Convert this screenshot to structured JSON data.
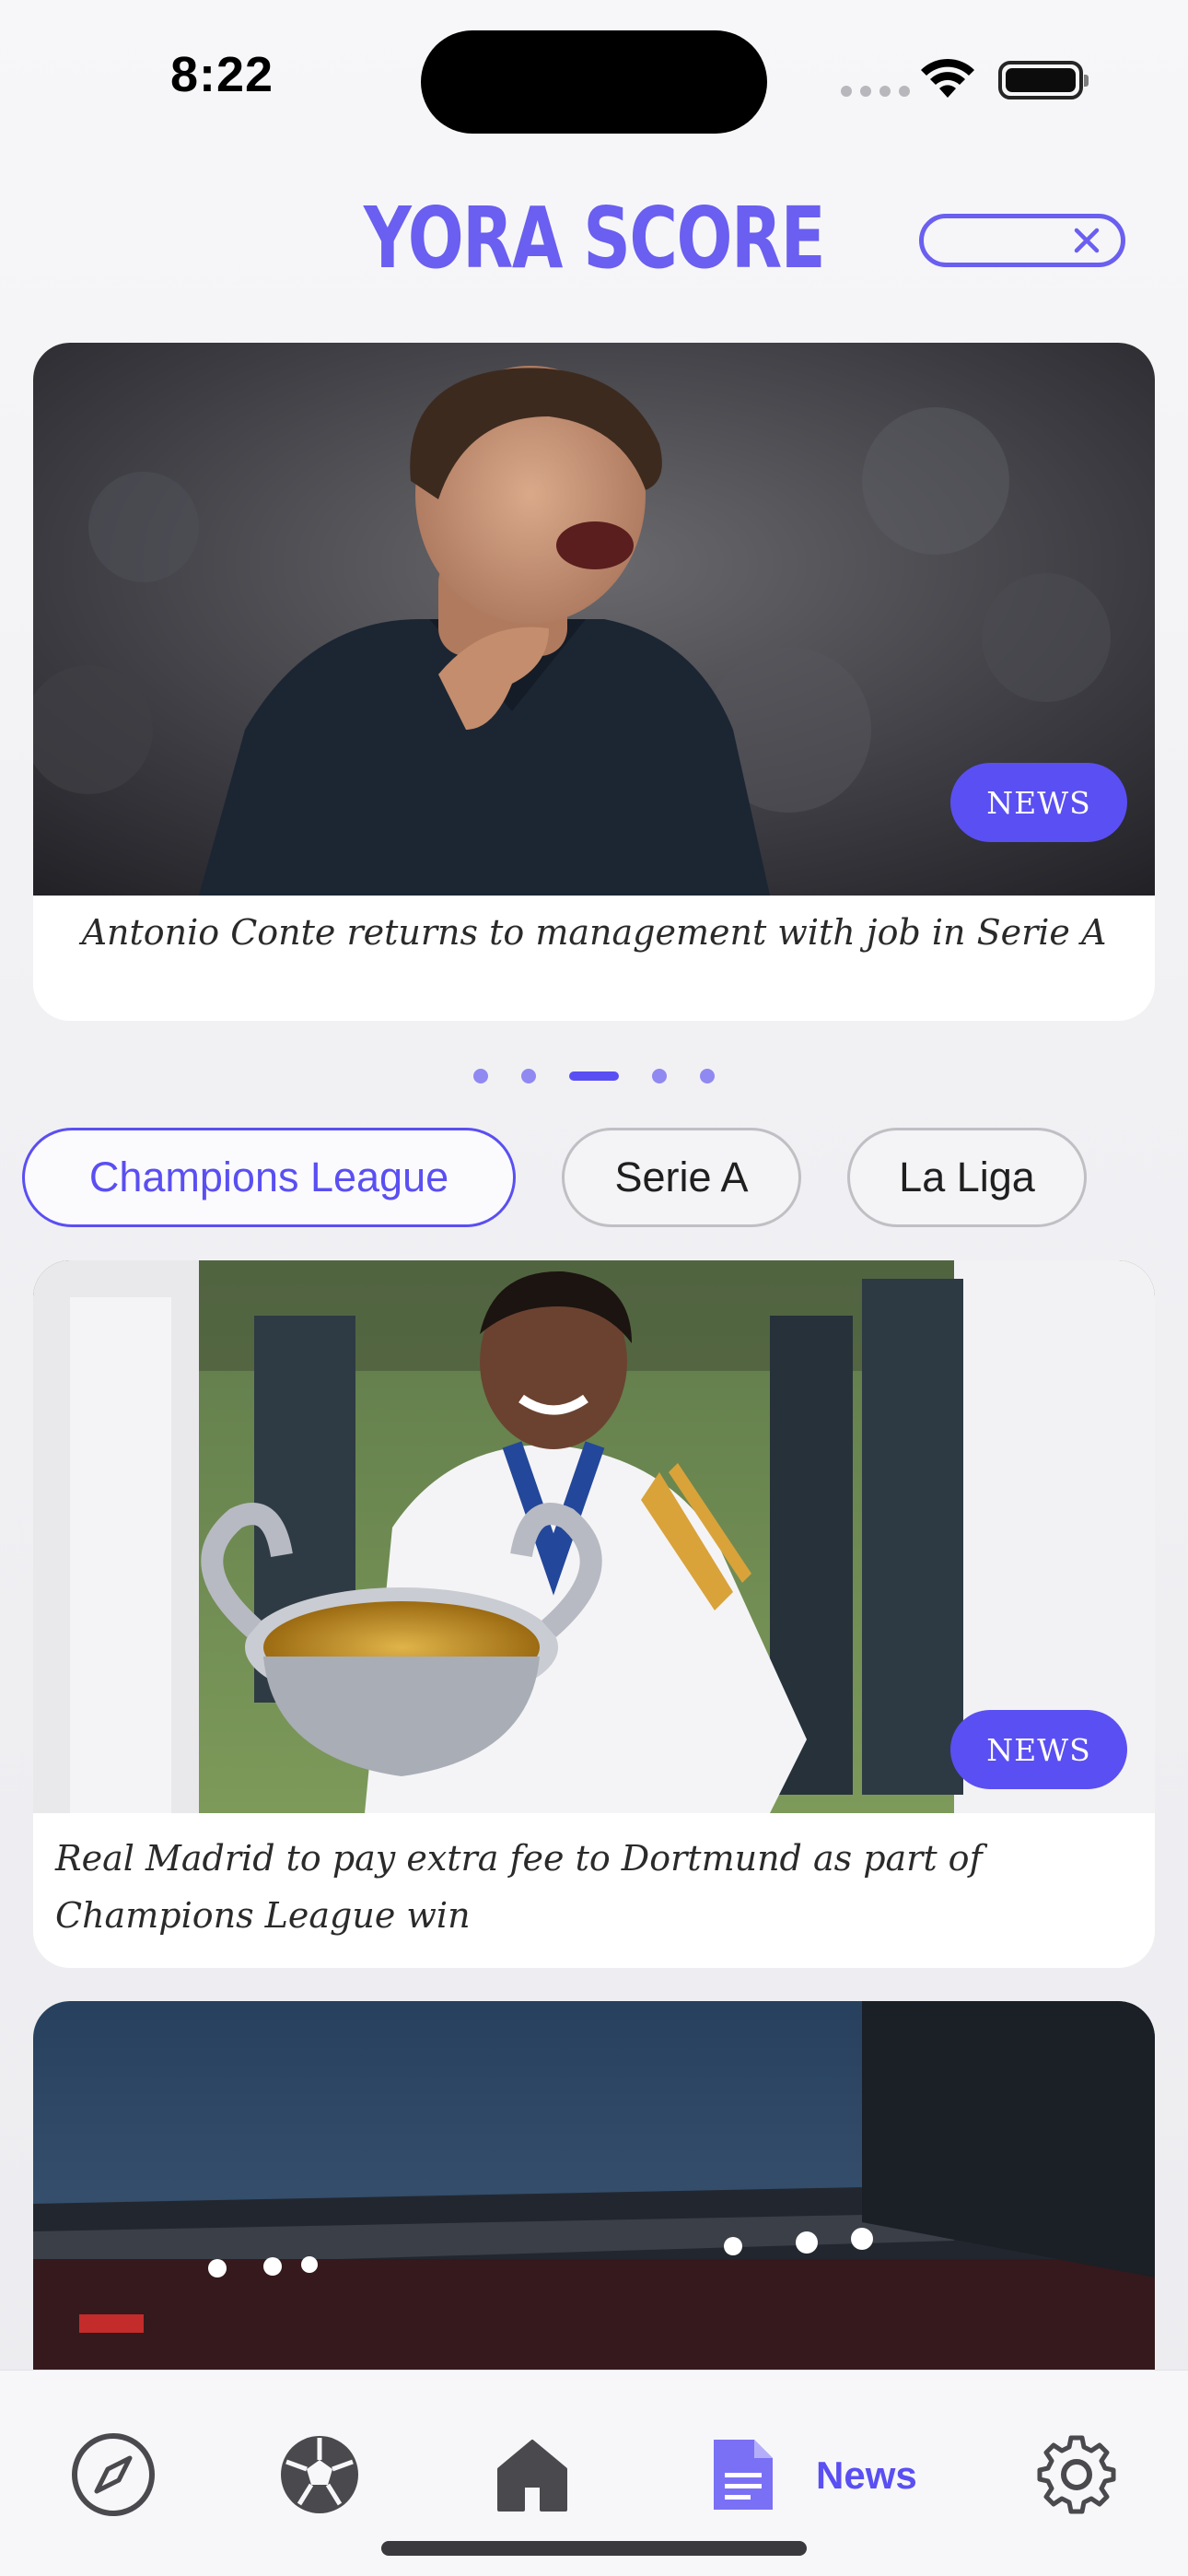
{
  "status_bar": {
    "time": "8:22"
  },
  "header": {
    "title": "YORA SCORE",
    "close_icon": "close-icon"
  },
  "carousel": {
    "slides_count": 5,
    "active_slide": 3,
    "hero": {
      "badge": "NEWS",
      "caption": "Antonio Conte returns to management with job in Serie A"
    }
  },
  "filters": {
    "tabs": [
      {
        "label": "Champions League",
        "active": true
      },
      {
        "label": "Serie A",
        "active": false
      },
      {
        "label": "La Liga",
        "active": false
      }
    ]
  },
  "feed": {
    "items": [
      {
        "badge": "NEWS",
        "caption": "Real Madrid to pay extra fee to Dortmund as part of Champions League win"
      }
    ]
  },
  "tab_bar": {
    "items": [
      {
        "icon": "compass-icon"
      },
      {
        "icon": "football-icon"
      },
      {
        "icon": "home-icon"
      },
      {
        "icon": "document-icon",
        "label": "News",
        "active": true
      },
      {
        "icon": "gear-icon"
      }
    ]
  },
  "colors": {
    "accent": "#5a4ff2",
    "brand": "#6a5ff0"
  }
}
